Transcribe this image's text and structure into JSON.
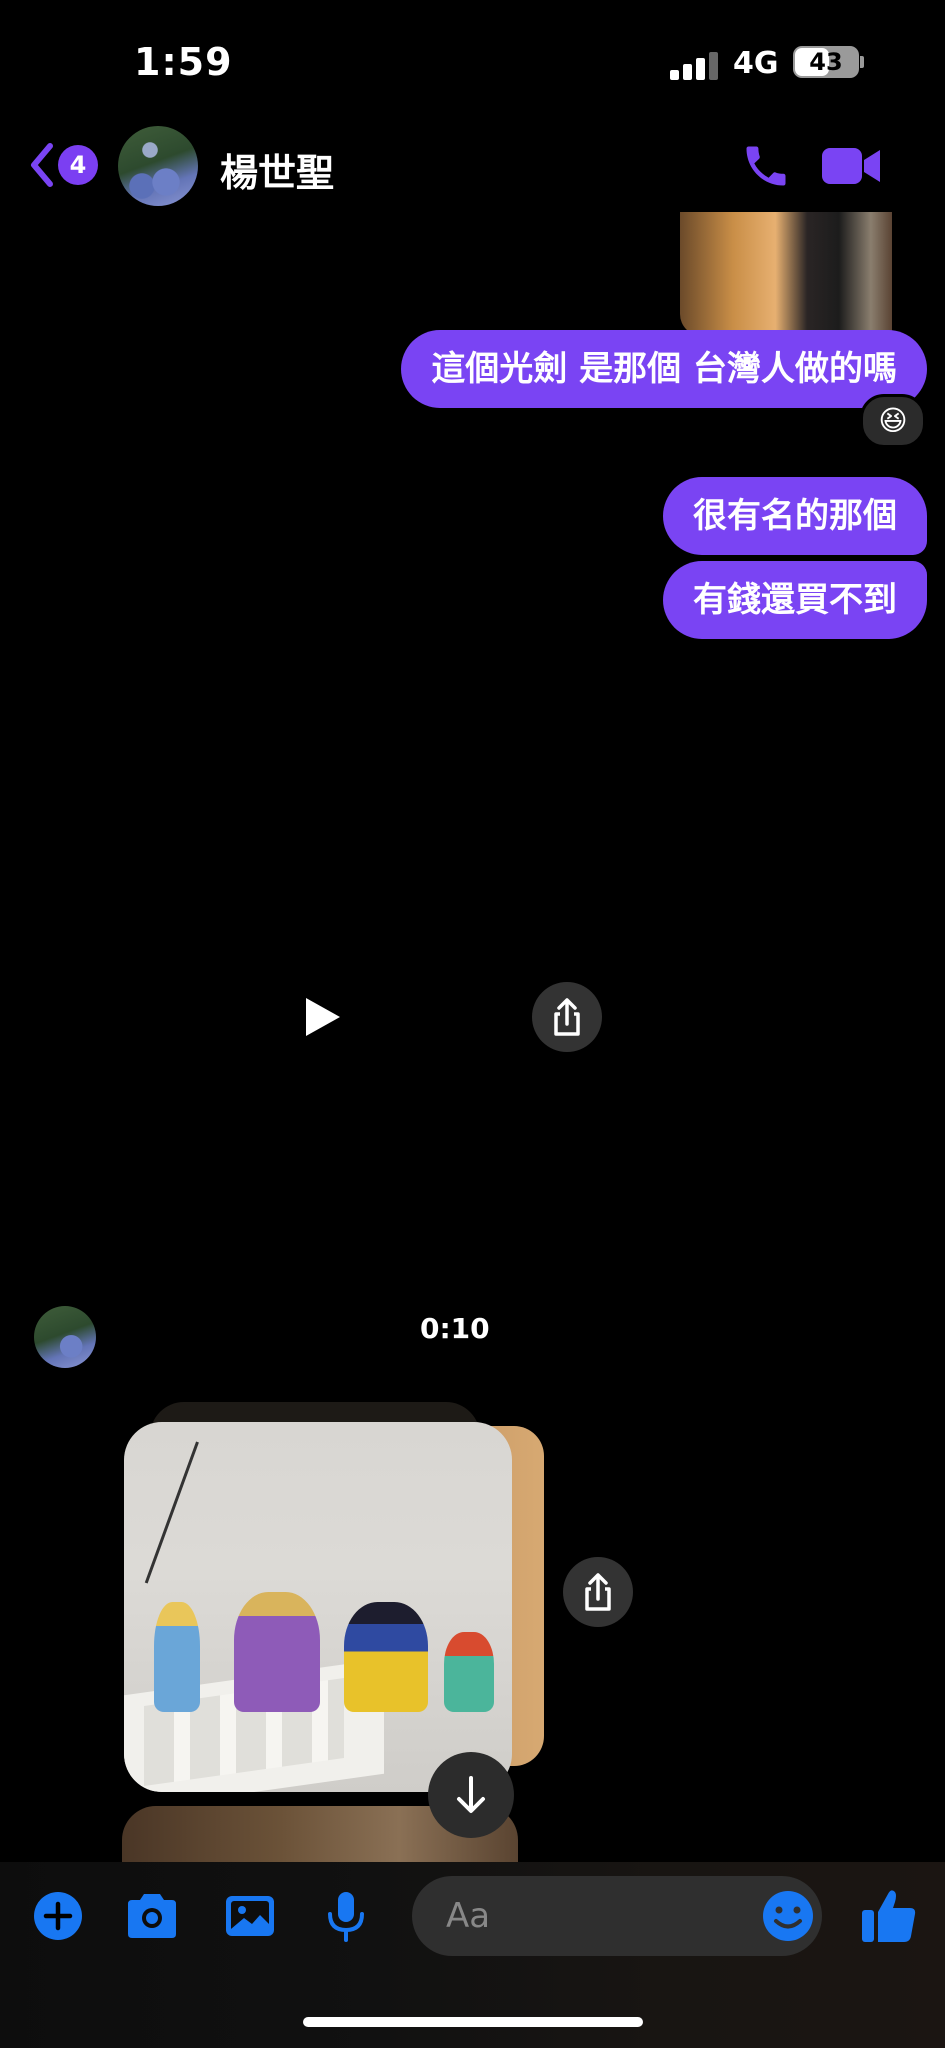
{
  "status_bar": {
    "time": "1:59",
    "network": "4G",
    "battery": "43"
  },
  "header": {
    "unread_count": "4",
    "contact_name": "楊世聖",
    "accent_color": "#7a44f3"
  },
  "messages": {
    "sent": [
      "這個光劍 是那個 台灣人做的嗎",
      "很有名的那個",
      "有錢還買不到"
    ],
    "reaction_emoji": "😆",
    "video_duration": "0:10"
  },
  "composer": {
    "placeholder": "Aa",
    "icon_color": "#1877f2"
  },
  "icons": [
    "back-chevron-icon",
    "phone-icon",
    "video-camera-icon",
    "play-icon",
    "share-icon",
    "arrow-down-icon",
    "plus-icon",
    "camera-icon",
    "image-icon",
    "microphone-icon",
    "emoji-icon",
    "thumbs-up-icon"
  ]
}
